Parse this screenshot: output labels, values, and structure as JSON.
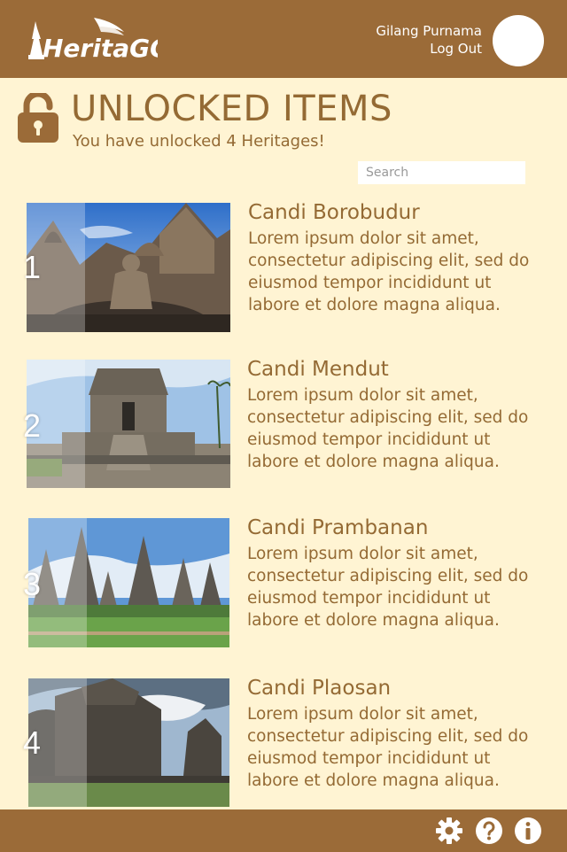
{
  "header": {
    "logo_text": "HeritaGO",
    "user_name": "Gilang Purnama",
    "logout_label": "Log Out"
  },
  "page": {
    "title": "UNLOCKED ITEMS",
    "subtitle": "You have unlocked 4 Heritages!"
  },
  "search": {
    "placeholder": "Search"
  },
  "items": [
    {
      "number": "1",
      "title": "Candi Borobudur",
      "description": "Lorem ipsum dolor sit amet, consectetur adipiscing elit, sed do eiusmod tempor incididunt ut labore et dolore magna aliqua."
    },
    {
      "number": "2",
      "title": "Candi Mendut",
      "description": "Lorem ipsum dolor sit amet, consectetur adipiscing elit, sed do eiusmod tempor incididunt ut labore et dolore magna aliqua."
    },
    {
      "number": "3",
      "title": "Candi Prambanan",
      "description": "Lorem ipsum dolor sit amet, consectetur adipiscing elit, sed do eiusmod tempor incididunt ut labore et dolore magna aliqua."
    },
    {
      "number": "4",
      "title": "Candi Plaosan",
      "description": "Lorem ipsum dolor sit amet, consectetur adipiscing elit, sed do eiusmod tempor incididunt ut labore et dolore magna aliqua."
    }
  ],
  "footer": {
    "icons": [
      "gear-icon",
      "help-icon",
      "info-icon"
    ]
  },
  "colors": {
    "brand": "#9b6b38",
    "background": "#fff4d3",
    "text": "#946a34"
  }
}
